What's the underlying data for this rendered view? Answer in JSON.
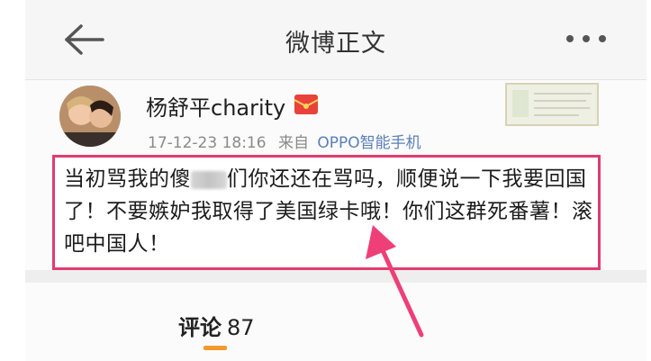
{
  "header": {
    "title": "微博正文",
    "back_icon": "arrow-left-icon",
    "more_icon": "more-dots-icon"
  },
  "post": {
    "author": "杨舒平charity",
    "badge_icon": "red-envelope-vip-icon",
    "timestamp": "17-12-23 18:16",
    "source_label": "来自",
    "source_device": "OPPO智能手机",
    "text_part1": "当初骂我的傻",
    "text_part2": "们你还还在骂吗，顺便说一下我要回国了！不要嫉妒我取得了美国绿卡哦！你们这群死番薯！滚吧中国人！"
  },
  "comments": {
    "label": "评论",
    "count": "87"
  },
  "colors": {
    "highlight_border": "#e23b71",
    "annotation_arrow": "#ee3f79",
    "tab_underline": "#f29a2f",
    "source_link": "#5a7fb8"
  }
}
